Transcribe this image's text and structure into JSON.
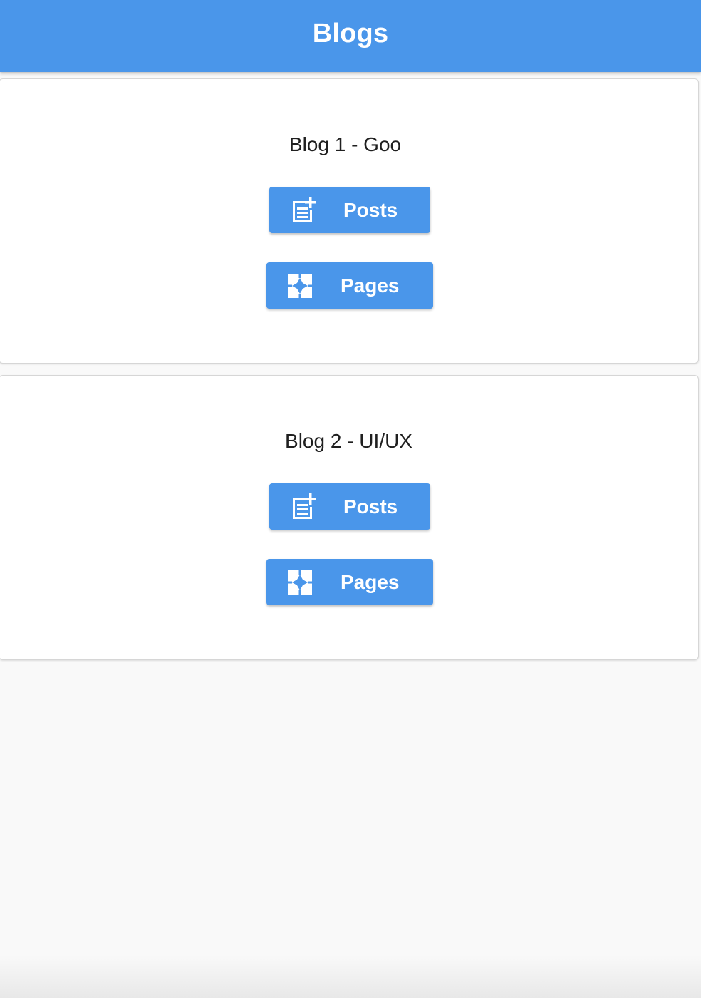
{
  "app_bar": {
    "title": "Blogs"
  },
  "blogs": [
    {
      "title": "Blog 1 - Goo",
      "posts_label": "Posts",
      "pages_label": "Pages"
    },
    {
      "title": "Blog 2 - UI/UX",
      "posts_label": "Posts",
      "pages_label": "Pages"
    }
  ],
  "icons": {
    "posts": "post-add-icon",
    "pages": "pages-icon"
  },
  "colors": {
    "primary": "#4a96ea",
    "background": "#f9f9f9",
    "card": "#ffffff",
    "text": "#1f1f1f"
  }
}
